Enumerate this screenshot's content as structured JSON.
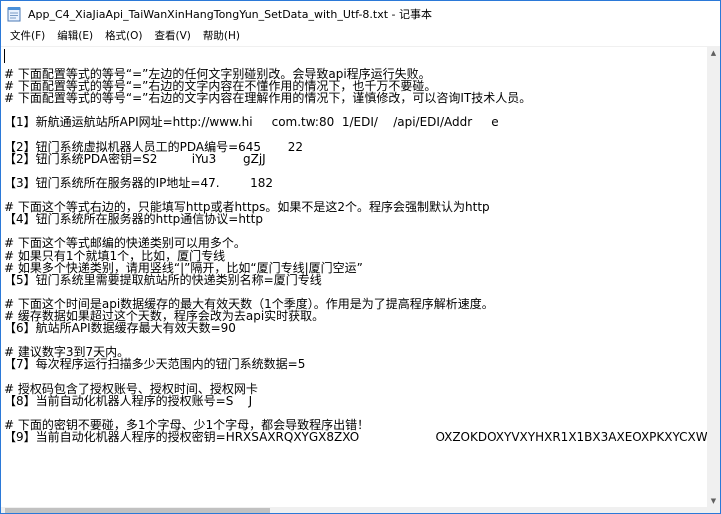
{
  "window": {
    "title": "App_C4_XiaJiaApi_TaiWanXinHangTongYun_SetData_with_Utf-8.txt - 记事本",
    "icon": "notepad-icon"
  },
  "menu": [
    {
      "id": "file",
      "label": "文件(F)"
    },
    {
      "id": "edit",
      "label": "编辑(E)"
    },
    {
      "id": "format",
      "label": "格式(O)"
    },
    {
      "id": "view",
      "label": "查看(V)"
    },
    {
      "id": "help",
      "label": "帮助(H)"
    }
  ],
  "lines": [
    "",
    "# 下面配置等式的等号“=”左边的任何文字别碰别改。会导致api程序运行失败。",
    "# 下面配置等式的等号“=”右边的文字内容在不懂作用的情况下，也千万不要碰。",
    "# 下面配置等式的等号“=”右边的文字内容在理解作用的情况下，谨慎修改，可以咨询IT技术人员。",
    "",
    "【1】新航通运航站所API网址=http://www.hi     com.tw:80  1/EDI/    /api/EDI/Addr     e",
    "",
    "【2】钮门系统虚拟机器人员工的PDA编号=645       22",
    "【2】钮门系统PDA密钥=S2         iYu3       gZjJ",
    "",
    "【3】钮门系统所在服务器的IP地址=47.        182",
    "",
    "# 下面这个等式右边的，只能填写http或者https。如果不是这2个。程序会强制默认为http",
    "【4】钮门系统所在服务器的http通信协议=http",
    "",
    "# 下面这个等式邮编的快递类别可以用多个。",
    "# 如果只有1个就填1个，比如，厦门专线",
    "# 如果多个快递类别，请用竖线“|”隔开，比如“厦门专线|厦门空运”",
    "【5】钮门系统里需要提取航站所的快递类别名称=厦门专线",
    "",
    "# 下面这个时间是api数据缓存的最大有效天数（1个季度）。作用是为了提高程序解析速度。",
    "# 缓存数据如果超过这个天数，程序会改为去api实时获取。",
    "【6】航站所API数据缓存最大有效天数=90",
    "",
    "# 建议数字3到7天内。",
    "【7】每次程序运行扫描多少天范围内的钮门系统数据=5",
    "",
    "# 授权码包含了授权账号、授权时间、授权网卡",
    "【8】当前自动化机器人程序的授权账号=S    J",
    "",
    "# 下面的密钥不要碰，多1个字母、少1个字母，都会导致程序出错！",
    "【9】当前自动化机器人程序的授权密钥=HRXSAXRQXYGX8ZXO                    OXZOKDOXYVXYHXR1X1BX3AXEOXPKXYCXWR"
  ]
}
